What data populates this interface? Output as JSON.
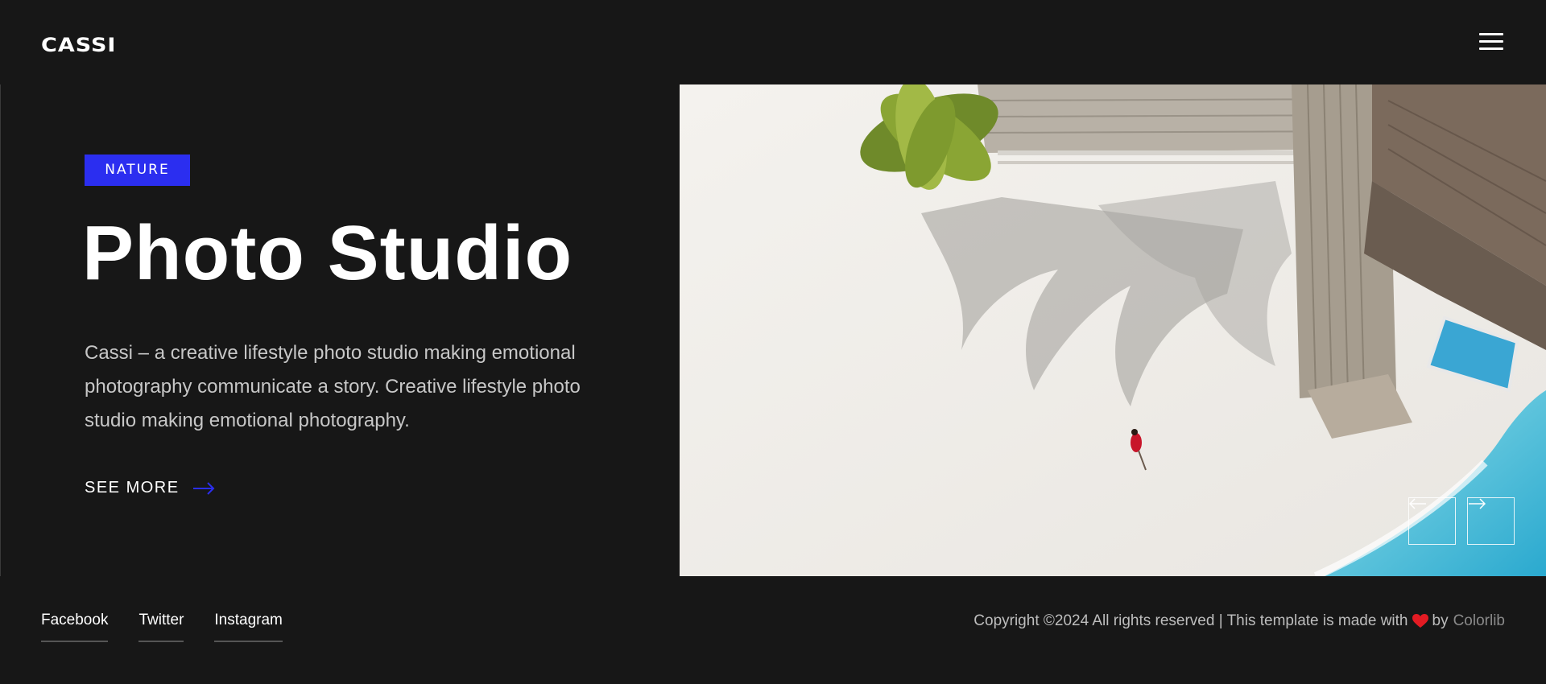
{
  "header": {
    "logo": "CASSI",
    "menu_icon": "hamburger-menu-icon"
  },
  "hero": {
    "badge": "NATURE",
    "title": "Photo Studio",
    "description": "Cassi – a creative lifestyle photo studio making emotional photography communicate a story. Creative lifestyle photo studio making emotional photography.",
    "cta_label": "SEE MORE",
    "cta_icon": "arrow-right-icon"
  },
  "slider": {
    "image_alt": "aerial beach with palm tree shadows and wooden villa",
    "prev_icon": "arrow-left-icon",
    "next_icon": "arrow-right-icon"
  },
  "footer": {
    "social_links": [
      "Facebook",
      "Twitter",
      "Instagram"
    ],
    "copyright_text": "Copyright ©2024 All rights reserved | This template is made with",
    "by_text": "by",
    "credit": "Colorlib",
    "heart_icon": "heart-icon"
  },
  "colors": {
    "background": "#171717",
    "accent": "#2b2ef0",
    "heart": "#e31b23",
    "text_muted": "#c7c7c7"
  }
}
